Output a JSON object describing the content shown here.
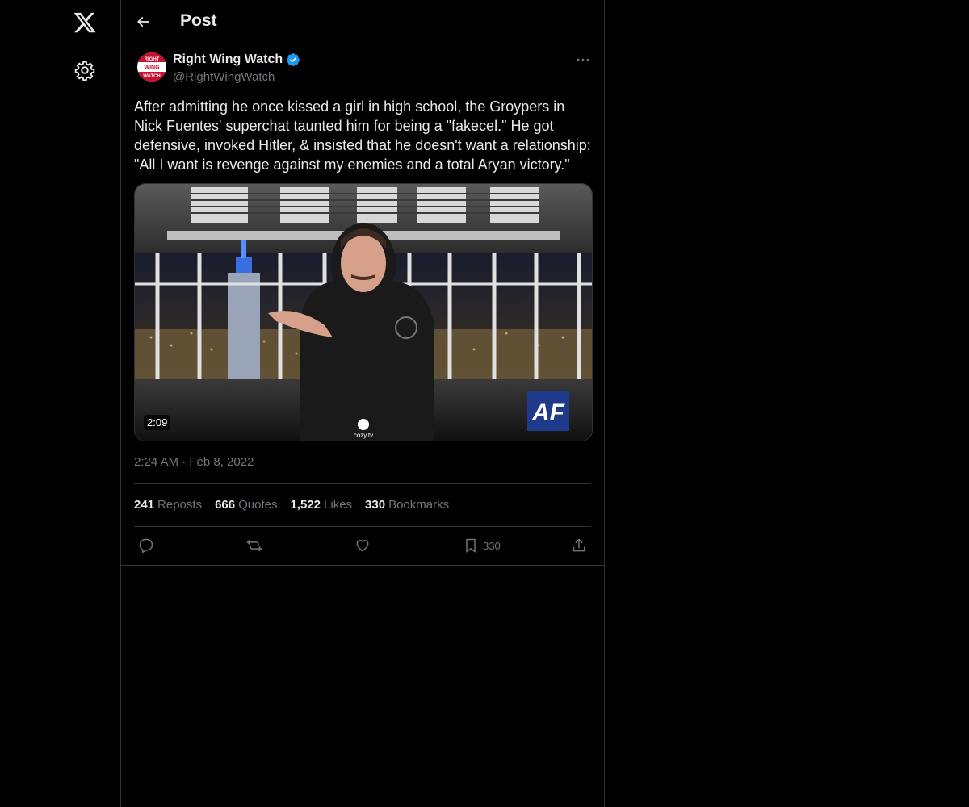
{
  "app": {
    "logo": "x-logo-icon",
    "settings_icon": "gear-icon"
  },
  "header": {
    "title": "Post",
    "back_icon": "arrow-left-icon"
  },
  "author": {
    "display_name": "Right Wing Watch",
    "handle": "@RightWingWatch",
    "verified": true,
    "avatar_text": [
      "RIGHT",
      "WING",
      "WATCH"
    ]
  },
  "post": {
    "text": "After admitting he once kissed a girl in high school, the Groypers in Nick Fuentes' superchat taunted him for being a \"fakecel.\" He got defensive, invoked Hitler, & insisted that he doesn't want a relationship: \"All I want is revenge against my enemies and a total Aryan victory.\"",
    "video": {
      "duration": "2:09",
      "overlay_logo": "AF",
      "watermark": "cozy.tv"
    },
    "timestamp": "2:24 AM · Feb 8, 2022"
  },
  "stats": [
    {
      "count": "241",
      "label": "Reposts"
    },
    {
      "count": "666",
      "label": "Quotes"
    },
    {
      "count": "1,522",
      "label": "Likes"
    },
    {
      "count": "330",
      "label": "Bookmarks"
    }
  ],
  "actions": {
    "reply_icon": "reply-icon",
    "repost_icon": "repost-icon",
    "like_icon": "heart-icon",
    "bookmark_icon": "bookmark-icon",
    "bookmark_count": "330",
    "share_icon": "share-icon"
  },
  "colors": {
    "background": "#000000",
    "text": "#e7e9ea",
    "muted": "#71767b",
    "border": "#2f3336",
    "verified": "#1d9bf0"
  }
}
